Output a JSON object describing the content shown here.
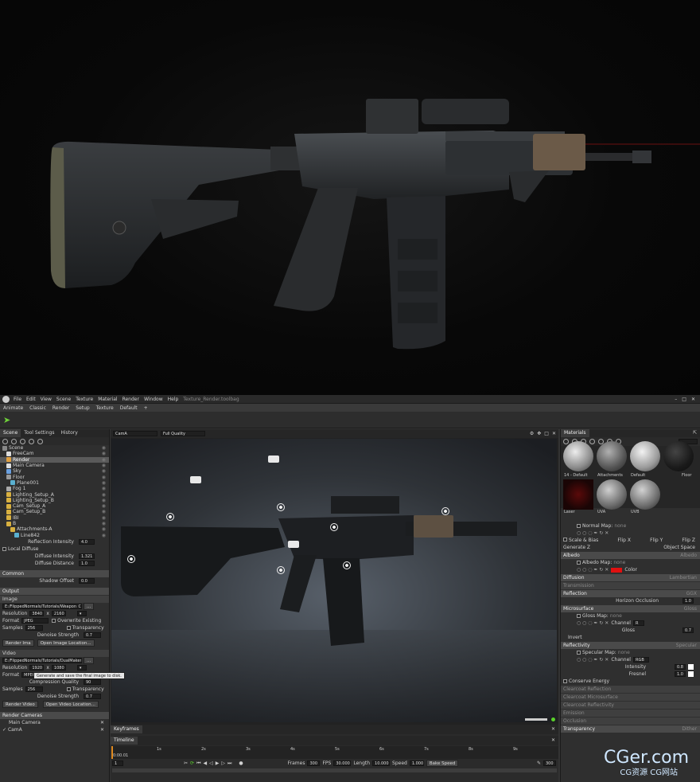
{
  "menu": {
    "items": [
      "File",
      "Edit",
      "View",
      "Scene",
      "Texture",
      "Material",
      "Render",
      "Window",
      "Help"
    ],
    "doc_title": "Texture_Render.toolbag"
  },
  "workspace_tabs": [
    "Animate",
    "Classic",
    "Render",
    "Setup",
    "Texture",
    "Default",
    "+"
  ],
  "left_panel": {
    "tabs": [
      "Scene",
      "Tool Settings",
      "History"
    ],
    "tree": [
      {
        "label": "Scene",
        "indent": 0,
        "icon": "scene-icon"
      },
      {
        "label": "FreeCam",
        "indent": 1,
        "icon": "camera-icon"
      },
      {
        "label": "Render",
        "indent": 1,
        "icon": "render-icon",
        "selected": true
      },
      {
        "label": "Main Camera",
        "indent": 1,
        "icon": "camera-icon"
      },
      {
        "label": "Sky",
        "indent": 1,
        "icon": "sky-icon"
      },
      {
        "label": "Floor",
        "indent": 1,
        "icon": "floor-icon"
      },
      {
        "label": "Plane001",
        "indent": 2,
        "icon": "mesh-icon"
      },
      {
        "label": "Fog 1",
        "indent": 1,
        "icon": "fog-icon"
      },
      {
        "label": "Lighting_Setup_A",
        "indent": 1,
        "icon": "folder-icon"
      },
      {
        "label": "Lighting_Setup_B",
        "indent": 1,
        "icon": "folder-icon"
      },
      {
        "label": "Cam_Setup_A",
        "indent": 1,
        "icon": "folder-icon"
      },
      {
        "label": "Cam_Setup_B",
        "indent": 1,
        "icon": "folder-icon"
      },
      {
        "label": "IBI",
        "indent": 1,
        "icon": "folder-icon"
      },
      {
        "label": "B",
        "indent": 1,
        "icon": "folder-icon"
      },
      {
        "label": "Attachments-A",
        "indent": 2,
        "icon": "folder-icon"
      },
      {
        "label": "Line842",
        "indent": 3,
        "icon": "mesh-icon"
      }
    ],
    "props": {
      "reflection_intensity_label": "Reflection Intensity",
      "reflection_intensity": "4.0",
      "local_diffuse_label": "Local Diffuse",
      "diffuse_intensity_label": "Diffuse Intensity",
      "diffuse_intensity": "1.321",
      "diffuse_distance_label": "Diffuse Distance",
      "diffuse_distance": "1.0",
      "common_label": "Common",
      "shadow_offset_label": "Shadow Offset",
      "shadow_offset": "0.0",
      "output_label": "Output",
      "image_label": "Image",
      "image_path": "E:/FlippedNormals/Tutorials/Weapon_C",
      "resolution_label": "Resolution",
      "res_w": "3840",
      "res_h": "2160",
      "res_x": "x",
      "format_label": "Format",
      "format_value": "JPEG",
      "overwrite_label": "Overwrite Existing",
      "samples_label": "Samples",
      "samples_value": "256",
      "transparency_label": "Transparency",
      "denoise_label": "Denoise Strength",
      "denoise_value": "0.7",
      "render_image_btn": "Render Ima",
      "open_image_loc_btn": "Open Image Location...",
      "tooltip": "Generate and save the final image to disk.",
      "video_label": "Video",
      "video_path": "E:/FlippedNormals/Tutorials/DualMaker",
      "vres_w": "1920",
      "vres_h": "1080",
      "vformat_value": "MPEG4",
      "compression_label": "Compression Quality",
      "compression_value": "90",
      "vsamples_value": "256",
      "vdenoise_value": "0.7",
      "render_video_btn": "Render Video",
      "open_video_loc_btn": "Open Video Location...",
      "render_cameras_label": "Render Cameras",
      "main_camera": "Main Camera",
      "cam_a": "CamA"
    }
  },
  "viewport": {
    "camera_select": "CamA",
    "quality_select": "Full Quality"
  },
  "timeline": {
    "tabs": [
      "Keyframes",
      "Timeline"
    ],
    "ticks": [
      "1s",
      "2s",
      "3s",
      "4s",
      "5s",
      "6s",
      "7s",
      "8s",
      "9s"
    ],
    "current_time": "0:00.01",
    "frame_field": "1",
    "frames_label": "Frames",
    "frames_value": "300",
    "fps_label": "FPS",
    "fps_value": "30.000",
    "length_label": "Length",
    "length_value": "10.000",
    "speed_label": "Speed",
    "speed_value": "1.000",
    "bake_speed_btn": "Bake Speed",
    "end_value": "300"
  },
  "right_panel": {
    "tab": "Materials",
    "search_value": "",
    "materials": [
      {
        "label": "14 - Default",
        "color": "#cfcfcf"
      },
      {
        "label": "Attachments",
        "color": "#8a8a8a"
      },
      {
        "label": "Default",
        "color": "#d9d9d9"
      },
      {
        "label": "Floor",
        "color": "#2a2a2a"
      },
      {
        "label": "Laser",
        "color": "#7a1010"
      },
      {
        "label": "UVA",
        "color": "#9a9a9a"
      },
      {
        "label": "UVB",
        "color": "#a0a0a0"
      }
    ],
    "normal_map_label": "Normal Map:",
    "none": "none",
    "scale_bias": "Scale & Bias",
    "flip_x": "Flip X",
    "flip_y": "Flip Y",
    "flip_z": "Flip Z",
    "generate_z": "Generate Z",
    "object_space": "Object Space",
    "albedo_head": "Albedo",
    "albedo_mode": "Albedo",
    "albedo_map_label": "Albedo Map:",
    "color_label": "Color",
    "albedo_color": "#e01010",
    "diffusion_head": "Diffusion",
    "diffusion_mode": "Lambertian",
    "transmission_head": "Transmission",
    "reflection_head": "Reflection",
    "reflection_mode": "GGX",
    "horizon_occlusion_label": "Horizon Occlusion",
    "horizon_occlusion": "1.0",
    "microsurface_head": "Microsurface",
    "microsurface_mode": "Gloss",
    "gloss_map_label": "Gloss Map:",
    "channel_label": "Channel",
    "gloss_channel": "R",
    "gloss_label": "Gloss",
    "gloss_value": "0.7",
    "invert_label": "Invert",
    "reflectivity_head": "Reflectivity",
    "reflectivity_mode": "Specular",
    "specular_map_label": "Specular Map:",
    "spec_channel": "RGB",
    "intensity_label": "Intensity",
    "intensity_value": "0.8",
    "fresnel_label": "Fresnel",
    "fresnel_value": "1.0",
    "conserve_energy": "Conserve Energy",
    "collapsed": [
      "Clearcoat Reflection",
      "Clearcoat Microsurface",
      "Clearcoat Reflectivity",
      "Emission",
      "Occlusion",
      "Transparency"
    ],
    "transparency_mode": "Dither"
  },
  "watermark": {
    "main": "CGer.com",
    "sub": "CG资源 CG网站"
  }
}
